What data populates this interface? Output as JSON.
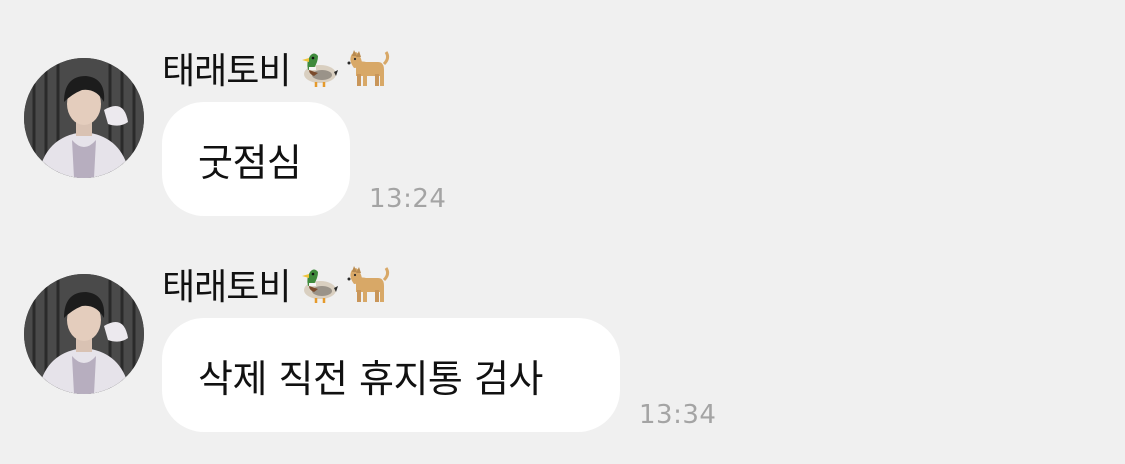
{
  "messages": [
    {
      "sender": "태래토비",
      "sender_emojis": [
        "mallard-duck-icon",
        "dog-icon"
      ],
      "text": "굿점심",
      "time": "13:24"
    },
    {
      "sender": "태래토비",
      "sender_emojis": [
        "mallard-duck-icon",
        "dog-icon"
      ],
      "text": "삭제 직전 휴지통 검사",
      "time": "13:34"
    }
  ],
  "colors": {
    "background": "#f0f0f0",
    "bubble": "#ffffff",
    "timestamp": "#a4a4a4"
  }
}
